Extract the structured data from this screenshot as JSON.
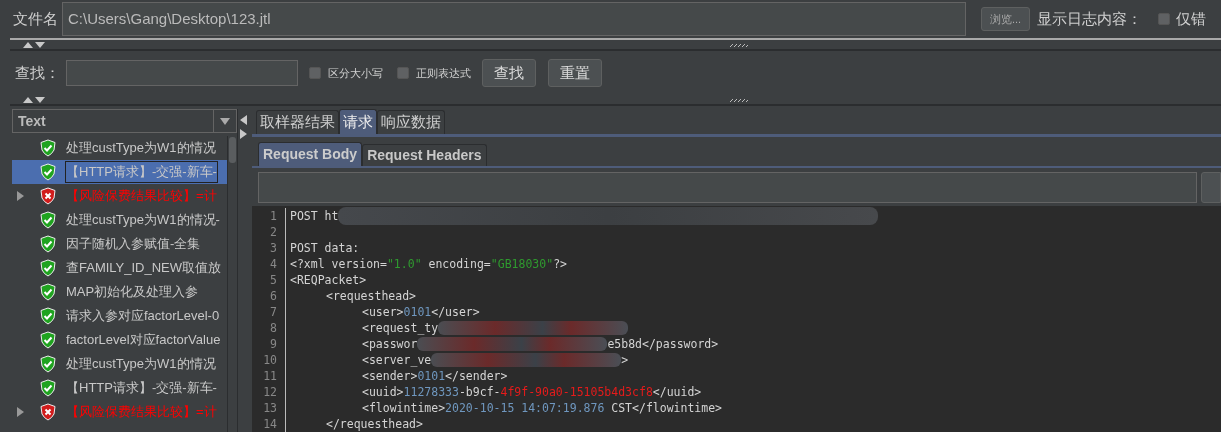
{
  "file_row": {
    "label": "文件名",
    "path": "C:\\Users\\Gang\\Desktop\\123.jtl",
    "browse_button": "浏览...",
    "log_label": "显示日志内容：",
    "errors_only": {
      "label": "仅错",
      "checked": false
    }
  },
  "search_row": {
    "label": "查找：",
    "case_sensitive": {
      "label": "区分大小写",
      "checked": false
    },
    "regex": {
      "label": "正则表达式",
      "checked": false
    },
    "find_button": "查找",
    "reset_button": "重置"
  },
  "renderer_select": {
    "value": "Text"
  },
  "results_tree": [
    {
      "label": "处理custType为W1的情况",
      "passed": true,
      "expandable": false,
      "selected": false
    },
    {
      "label": "【HTTP请求】-交强-新车-",
      "passed": true,
      "expandable": false,
      "selected": true
    },
    {
      "label": "【风险保费结果比较】=计",
      "passed": false,
      "expandable": true,
      "selected": false
    },
    {
      "label": "处理custType为W1的情况-",
      "passed": true,
      "expandable": false,
      "selected": false
    },
    {
      "label": "因子随机入参赋值-全集",
      "passed": true,
      "expandable": false,
      "selected": false
    },
    {
      "label": "查FAMILY_ID_NEW取值放",
      "passed": true,
      "expandable": false,
      "selected": false
    },
    {
      "label": "MAP初始化及处理入参",
      "passed": true,
      "expandable": false,
      "selected": false
    },
    {
      "label": "请求入参对应factorLevel-0",
      "passed": true,
      "expandable": false,
      "selected": false
    },
    {
      "label": "factorLevel对应factorValue",
      "passed": true,
      "expandable": false,
      "selected": false
    },
    {
      "label": "处理custType为W1的情况",
      "passed": true,
      "expandable": false,
      "selected": false
    },
    {
      "label": "【HTTP请求】-交强-新车-",
      "passed": true,
      "expandable": false,
      "selected": false
    },
    {
      "label": "【风险保费结果比较】=计",
      "passed": false,
      "expandable": true,
      "selected": false
    }
  ],
  "result_tabs": [
    {
      "label": "取样器结果",
      "selected": false
    },
    {
      "label": "请求",
      "selected": true
    },
    {
      "label": "响应数据",
      "selected": false
    }
  ],
  "request_tabs": [
    {
      "label": "Request Body",
      "selected": true
    },
    {
      "label": "Request Headers",
      "selected": false
    }
  ],
  "code_lines": [
    {
      "number": "1",
      "segments": [
        {
          "kind": "plain",
          "text": "POST ht"
        },
        {
          "kind": "redacted_long"
        }
      ]
    },
    {
      "number": "2"
    },
    {
      "number": "3",
      "segments": [
        {
          "kind": "plain",
          "text": "POST data:"
        }
      ]
    },
    {
      "number": "4",
      "segments": [
        {
          "kind": "plain",
          "text": "<?xml version="
        },
        {
          "kind": "string",
          "text": "\"1.0\""
        },
        {
          "kind": "plain",
          "text": " encoding="
        },
        {
          "kind": "string",
          "text": "\"GB18030\""
        },
        {
          "kind": "plain",
          "text": "?>"
        }
      ]
    },
    {
      "number": "5",
      "segments": [
        {
          "kind": "plain",
          "text": "<REQPacket>"
        }
      ]
    },
    {
      "number": "6",
      "segments": [
        {
          "kind": "indent1"
        },
        {
          "kind": "plain",
          "text": "<requesthead>"
        }
      ]
    },
    {
      "number": "7",
      "segments": [
        {
          "kind": "indent2"
        },
        {
          "kind": "plain",
          "text": "<user>"
        },
        {
          "kind": "number",
          "text": "0101"
        },
        {
          "kind": "plain",
          "text": "</user>"
        }
      ]
    },
    {
      "number": "8",
      "segments": [
        {
          "kind": "indent2"
        },
        {
          "kind": "plain",
          "text": "<request_ty"
        },
        {
          "kind": "redacted"
        }
      ]
    },
    {
      "number": "9",
      "segments": [
        {
          "kind": "indent2"
        },
        {
          "kind": "plain",
          "text": "<passwor"
        },
        {
          "kind": "redacted"
        },
        {
          "kind": "plain",
          "text": "e5b8d</password>"
        }
      ]
    },
    {
      "number": "10",
      "segments": [
        {
          "kind": "indent2"
        },
        {
          "kind": "plain",
          "text": "<server_ve"
        },
        {
          "kind": "redacted"
        },
        {
          "kind": "plain",
          "text": ">"
        }
      ]
    },
    {
      "number": "11",
      "segments": [
        {
          "kind": "indent2"
        },
        {
          "kind": "plain",
          "text": "<sender>"
        },
        {
          "kind": "number",
          "text": "0101"
        },
        {
          "kind": "plain",
          "text": "</sender>"
        }
      ]
    },
    {
      "number": "12",
      "segments": [
        {
          "kind": "indent2"
        },
        {
          "kind": "plain",
          "text": "<uuid>"
        },
        {
          "kind": "number",
          "text": "11278333"
        },
        {
          "kind": "plain",
          "text": "-b9cf-"
        },
        {
          "kind": "error",
          "text": "4f9f-90a0-15105b4d3cf8"
        },
        {
          "kind": "plain",
          "text": "</uuid>"
        }
      ]
    },
    {
      "number": "13",
      "segments": [
        {
          "kind": "indent2"
        },
        {
          "kind": "plain",
          "text": "<flowintime>"
        },
        {
          "kind": "number",
          "text": "2020-10-15 14:07:19.876"
        },
        {
          "kind": "plain",
          "text": " CST</flowintime>"
        }
      ]
    },
    {
      "number": "14",
      "segments": [
        {
          "kind": "indent1"
        },
        {
          "kind": "plain",
          "text": "</requesthead>"
        }
      ]
    }
  ]
}
